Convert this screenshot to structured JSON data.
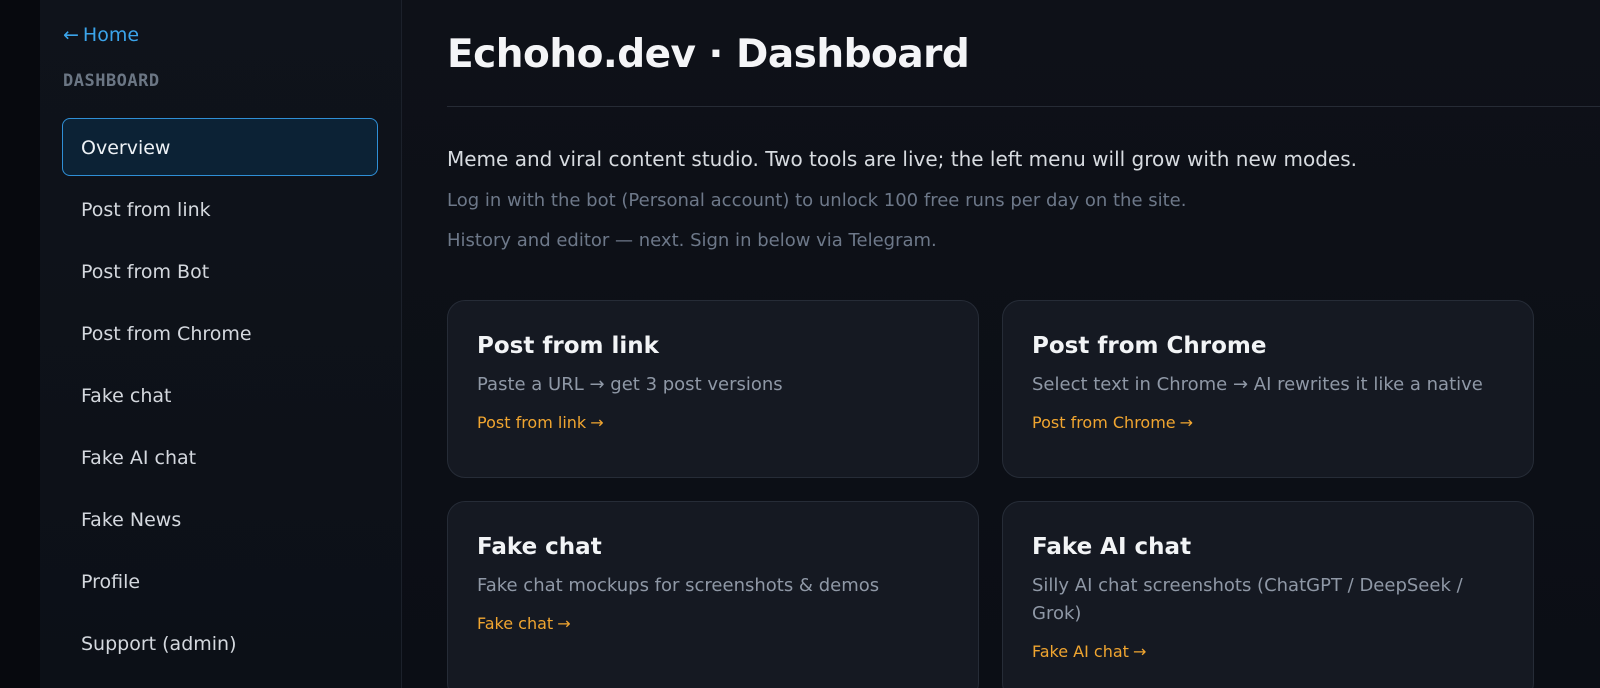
{
  "sidebar": {
    "home_label": "Home",
    "home_arrow": "←",
    "section_title": "DASHBOARD",
    "items": [
      {
        "label": "Overview",
        "active": true
      },
      {
        "label": "Post from link"
      },
      {
        "label": "Post from Bot"
      },
      {
        "label": "Post from Chrome"
      },
      {
        "label": "Fake chat"
      },
      {
        "label": "Fake AI chat"
      },
      {
        "label": "Fake News"
      },
      {
        "label": "Profile"
      },
      {
        "label": "Support (admin)"
      }
    ]
  },
  "main": {
    "title": "Echoho.dev · Dashboard",
    "intro": "Meme and viral content studio. Two tools are live; the left menu will grow with new modes.",
    "notes": [
      "Log in with the bot (Personal account) to unlock 100 free runs per day on the site.",
      "History and editor — next. Sign in below via Telegram."
    ],
    "cards": [
      {
        "title": "Post from link",
        "description": "Paste a URL → get 3 post versions",
        "link": "Post from link",
        "arrow": "→"
      },
      {
        "title": "Post from Chrome",
        "description": "Select text in Chrome → AI rewrites it like a native",
        "link": "Post from Chrome",
        "arrow": "→"
      },
      {
        "title": "Fake chat",
        "description": "Fake chat mockups for screenshots & demos",
        "link": "Fake chat",
        "arrow": "→"
      },
      {
        "title": "Fake AI chat",
        "description": "Silly AI chat screenshots (ChatGPT / DeepSeek / Grok)",
        "link": "Fake AI chat",
        "arrow": "→"
      }
    ]
  },
  "colors": {
    "accent_blue": "#3ba4ea",
    "link_orange": "#f0a530",
    "active_border": "#2f8fd6",
    "background": "#0d1017"
  }
}
